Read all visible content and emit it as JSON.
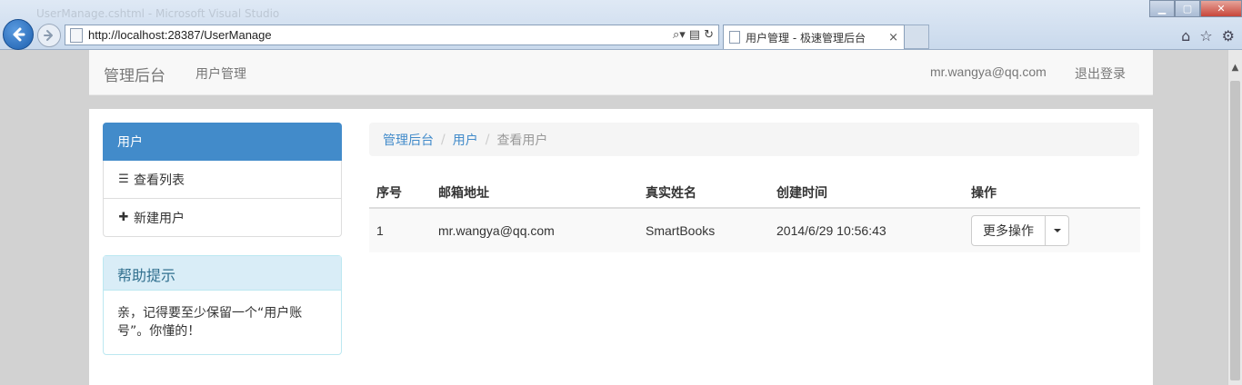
{
  "browser": {
    "window_title": "UserManage.cshtml - Microsoft Visual Studio",
    "url": "http://localhost:28387/UserManage",
    "tab_title": "用户管理 - 极速管理后台",
    "tab_close": "×",
    "icons": [
      "back-arrow-icon",
      "forward-arrow-icon",
      "search-icon",
      "refresh-icon",
      "home-icon",
      "star-icon",
      "gear-icon"
    ]
  },
  "navbar": {
    "brand": "管理后台",
    "users_link": "用户管理",
    "user_email": "mr.wangya@qq.com",
    "logout": "退出登录"
  },
  "sidebar": {
    "header": "用户",
    "items": [
      {
        "label": "查看列表",
        "icon": "list-icon"
      },
      {
        "label": "新建用户",
        "icon": "plus-icon"
      }
    ]
  },
  "help": {
    "title": "帮助提示",
    "body": "亲，记得要至少保留一个“用户账号”。你懂的！"
  },
  "breadcrumb": {
    "home": "管理后台",
    "section": "用户",
    "current": "查看用户",
    "separator": "/"
  },
  "table": {
    "columns": [
      "序号",
      "邮箱地址",
      "真实姓名",
      "创建时间",
      "操作"
    ],
    "rows": [
      {
        "index": "1",
        "email": "mr.wangya@qq.com",
        "name": "SmartBooks",
        "created": "2014/6/29 10:56:43",
        "action_label": "更多操作"
      }
    ]
  },
  "colors": {
    "accent": "#428bca",
    "info_bg": "#d9edf7",
    "info_text": "#31708f"
  }
}
